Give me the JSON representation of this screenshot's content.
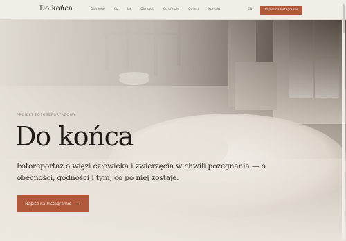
{
  "header": {
    "logo": "Do końca",
    "nav": [
      "Dlaczego",
      "Co",
      "Jak",
      "Dla kogo",
      "Co oferuję",
      "Galeria",
      "Kontakt"
    ],
    "lang": "EN",
    "cta": "Napisz na Instagramie"
  },
  "hero": {
    "eyebrow": "PROJEKT FOTOREPORTAŻOWY",
    "title": "Do końca",
    "lead": "Fotoreportaż o więzi człowieka i zwierzęcia w chwili pożegnania — o obecności, godności i tym, co po niej zostaje.",
    "cta": "Napisz na Instagramie",
    "cta_arrow": "⟶",
    "image_description": "room-with-chair-bowl-blanket-window"
  },
  "colors": {
    "accent": "#b0583a",
    "header_bg": "#f1ede7",
    "title": "#1f1a16"
  }
}
